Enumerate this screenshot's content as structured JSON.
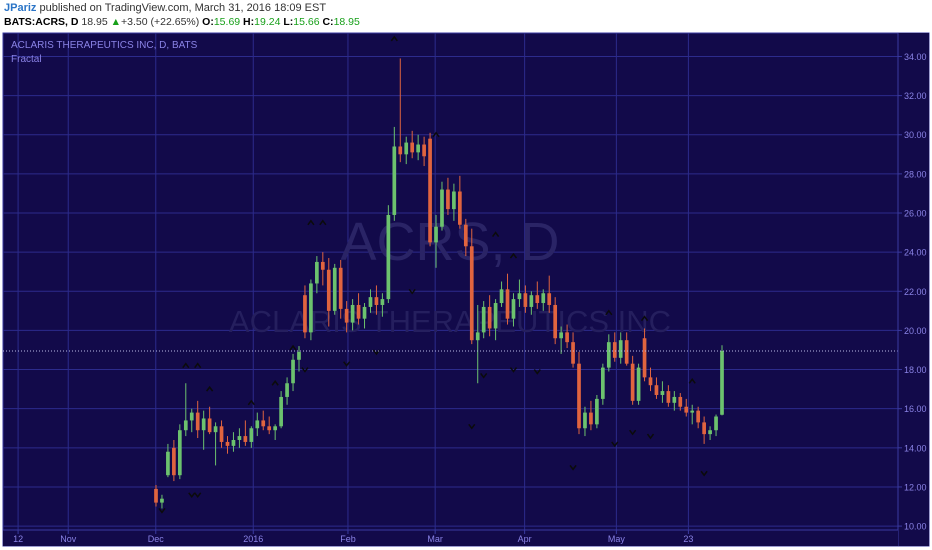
{
  "header": {
    "author": "JPariz",
    "published_text": "published on TradingView.com, March 31, 2016 18:09 EST",
    "symbol": "BATS:ACRS, D",
    "last": "18.95",
    "change_arrow": "▲",
    "change": "+3.50 (+22.65%)",
    "o_label": "O:",
    "o_value": "15.69",
    "h_label": "H:",
    "h_value": "19.24",
    "l_label": "L:",
    "l_value": "15.66",
    "c_label": "C:",
    "c_value": "18.95"
  },
  "chart_data": {
    "type": "candlestick",
    "title": "ACLARIS THERAPEUTICS INC, D, BATS",
    "indicator": "Fractal",
    "watermark_symbol": "ACRS, D",
    "watermark_name": "ACLARIS THERAPEUTICS INC",
    "y_ticks": [
      "10.00",
      "12.00",
      "14.00",
      "16.00",
      "18.00",
      "20.00",
      "22.00",
      "24.00",
      "26.00",
      "28.00",
      "30.00",
      "32.00",
      "34.00"
    ],
    "ylim": [
      9.8,
      35.2
    ],
    "x_ticks": [
      "12",
      "Nov",
      "Dec",
      "2016",
      "Feb",
      "Mar",
      "Apr",
      "May",
      "23"
    ],
    "current_price": 18.95,
    "colors": {
      "background": "#120a4a",
      "grid": "#2c2b8c",
      "up": "#6cc26e",
      "down": "#e0643f",
      "fractal": "#0b0b0b",
      "price_line": "#b9bbe6"
    },
    "candles": [
      [
        11.9,
        12.1,
        11.0,
        11.2
      ],
      [
        11.2,
        11.6,
        10.9,
        11.4
      ],
      [
        12.6,
        14.2,
        12.5,
        13.8
      ],
      [
        14.0,
        14.4,
        12.3,
        12.6
      ],
      [
        12.6,
        15.2,
        12.4,
        14.9
      ],
      [
        14.9,
        17.3,
        14.6,
        15.4
      ],
      [
        15.4,
        16.0,
        14.8,
        15.8
      ],
      [
        15.8,
        16.4,
        14.5,
        14.9
      ],
      [
        14.9,
        15.9,
        13.9,
        15.5
      ],
      [
        15.5,
        16.1,
        14.7,
        14.8
      ],
      [
        14.8,
        15.3,
        13.1,
        15.1
      ],
      [
        15.1,
        15.4,
        14.0,
        14.3
      ],
      [
        14.3,
        14.6,
        13.7,
        14.1
      ],
      [
        14.1,
        14.8,
        13.8,
        14.4
      ],
      [
        14.4,
        15.0,
        14.0,
        14.6
      ],
      [
        14.6,
        15.4,
        14.1,
        14.3
      ],
      [
        14.3,
        15.1,
        14.0,
        15.0
      ],
      [
        15.0,
        15.8,
        14.6,
        15.4
      ],
      [
        15.4,
        15.9,
        14.9,
        15.1
      ],
      [
        15.1,
        15.6,
        14.7,
        14.9
      ],
      [
        14.9,
        15.2,
        14.4,
        15.1
      ],
      [
        15.1,
        16.9,
        15.0,
        16.6
      ],
      [
        16.6,
        17.6,
        16.2,
        17.3
      ],
      [
        17.3,
        18.8,
        16.9,
        18.5
      ],
      [
        18.5,
        19.2,
        17.9,
        18.9
      ],
      [
        21.8,
        22.3,
        19.6,
        19.9
      ],
      [
        19.9,
        22.6,
        19.5,
        22.4
      ],
      [
        22.4,
        23.8,
        21.9,
        23.5
      ],
      [
        23.5,
        24.0,
        22.3,
        23.1
      ],
      [
        23.1,
        23.7,
        20.2,
        21.0
      ],
      [
        21.0,
        23.4,
        20.8,
        23.2
      ],
      [
        23.2,
        23.6,
        20.6,
        21.1
      ],
      [
        21.1,
        21.5,
        19.9,
        20.4
      ],
      [
        20.4,
        21.6,
        20.0,
        21.3
      ],
      [
        21.3,
        21.9,
        20.3,
        20.6
      ],
      [
        20.6,
        21.4,
        20.1,
        21.2
      ],
      [
        21.2,
        22.1,
        20.9,
        21.7
      ],
      [
        21.7,
        22.3,
        20.8,
        21.3
      ],
      [
        21.3,
        21.9,
        20.7,
        21.6
      ],
      [
        21.6,
        26.4,
        21.4,
        25.9
      ],
      [
        25.9,
        30.4,
        25.6,
        29.4
      ],
      [
        29.4,
        33.9,
        28.6,
        29.0
      ],
      [
        29.0,
        29.9,
        28.5,
        29.6
      ],
      [
        29.6,
        30.2,
        28.8,
        29.1
      ],
      [
        29.1,
        30.0,
        28.7,
        29.5
      ],
      [
        29.5,
        29.9,
        28.4,
        28.9
      ],
      [
        29.8,
        30.1,
        24.3,
        24.5
      ],
      [
        24.5,
        25.9,
        23.2,
        25.3
      ],
      [
        25.3,
        27.6,
        25.1,
        27.2
      ],
      [
        27.2,
        27.8,
        25.9,
        26.2
      ],
      [
        26.2,
        27.5,
        25.6,
        27.1
      ],
      [
        27.1,
        27.9,
        25.2,
        25.4
      ],
      [
        25.4,
        25.7,
        23.8,
        24.3
      ],
      [
        24.3,
        25.2,
        19.3,
        19.5
      ],
      [
        19.5,
        21.3,
        17.3,
        19.9
      ],
      [
        19.9,
        21.5,
        19.6,
        21.2
      ],
      [
        21.2,
        21.8,
        19.7,
        20.1
      ],
      [
        20.1,
        21.6,
        19.5,
        21.4
      ],
      [
        21.4,
        22.5,
        21.2,
        22.1
      ],
      [
        22.1,
        22.9,
        20.3,
        20.6
      ],
      [
        20.6,
        21.9,
        20.2,
        21.6
      ],
      [
        21.6,
        22.6,
        21.2,
        21.9
      ],
      [
        21.9,
        22.3,
        20.9,
        21.2
      ],
      [
        21.2,
        22.0,
        20.8,
        21.8
      ],
      [
        21.8,
        22.5,
        21.1,
        21.4
      ],
      [
        21.4,
        22.1,
        21.0,
        21.9
      ],
      [
        21.9,
        22.8,
        20.9,
        21.3
      ],
      [
        21.3,
        21.7,
        19.3,
        19.6
      ],
      [
        19.6,
        20.2,
        18.8,
        19.9
      ],
      [
        19.9,
        20.3,
        19.1,
        19.4
      ],
      [
        19.4,
        19.9,
        18.1,
        18.3
      ],
      [
        18.3,
        18.9,
        14.7,
        15.0
      ],
      [
        15.0,
        16.1,
        14.6,
        15.8
      ],
      [
        15.8,
        16.4,
        14.9,
        15.2
      ],
      [
        15.2,
        16.7,
        15.0,
        16.5
      ],
      [
        16.5,
        18.3,
        16.2,
        18.1
      ],
      [
        18.1,
        19.8,
        17.9,
        19.4
      ],
      [
        19.4,
        19.9,
        18.4,
        18.6
      ],
      [
        18.6,
        19.9,
        18.3,
        19.5
      ],
      [
        19.5,
        19.9,
        18.2,
        18.3
      ],
      [
        18.3,
        18.7,
        16.2,
        16.4
      ],
      [
        16.4,
        18.3,
        16.2,
        18.1
      ],
      [
        19.6,
        20.1,
        17.4,
        17.6
      ],
      [
        17.6,
        18.1,
        16.9,
        17.2
      ],
      [
        17.2,
        17.6,
        16.5,
        16.7
      ],
      [
        16.7,
        17.4,
        16.3,
        16.9
      ],
      [
        16.9,
        17.2,
        16.1,
        16.3
      ],
      [
        16.3,
        16.9,
        15.9,
        16.6
      ],
      [
        16.6,
        16.8,
        15.9,
        16.1
      ],
      [
        16.1,
        16.5,
        15.6,
        15.8
      ],
      [
        15.8,
        16.2,
        15.2,
        15.9
      ],
      [
        15.9,
        16.1,
        15.0,
        15.3
      ],
      [
        15.3,
        15.6,
        14.2,
        14.7
      ],
      [
        14.7,
        15.1,
        14.4,
        14.9
      ],
      [
        14.9,
        15.7,
        14.6,
        15.6
      ],
      [
        15.69,
        19.24,
        15.66,
        18.95
      ]
    ],
    "fractals_up": [
      [
        5,
        18.2
      ],
      [
        7,
        18.2
      ],
      [
        9,
        17.0
      ],
      [
        16,
        16.3
      ],
      [
        20,
        17.3
      ],
      [
        23,
        19.1
      ],
      [
        26,
        25.5
      ],
      [
        28,
        25.5
      ],
      [
        40,
        34.9
      ],
      [
        47,
        30.0
      ],
      [
        57,
        24.9
      ],
      [
        60,
        23.8
      ],
      [
        76,
        20.9
      ],
      [
        82,
        20.6
      ],
      [
        90,
        17.4
      ]
    ],
    "fractals_down": [
      [
        1,
        10.8
      ],
      [
        6,
        11.6
      ],
      [
        7,
        11.6
      ],
      [
        25,
        18.0
      ],
      [
        32,
        18.3
      ],
      [
        37,
        18.9
      ],
      [
        43,
        22.0
      ],
      [
        53,
        15.1
      ],
      [
        55,
        17.7
      ],
      [
        60,
        18.0
      ],
      [
        64,
        17.9
      ],
      [
        70,
        13.0
      ],
      [
        77,
        14.2
      ],
      [
        80,
        14.8
      ],
      [
        83,
        14.6
      ],
      [
        92,
        12.7
      ]
    ]
  }
}
